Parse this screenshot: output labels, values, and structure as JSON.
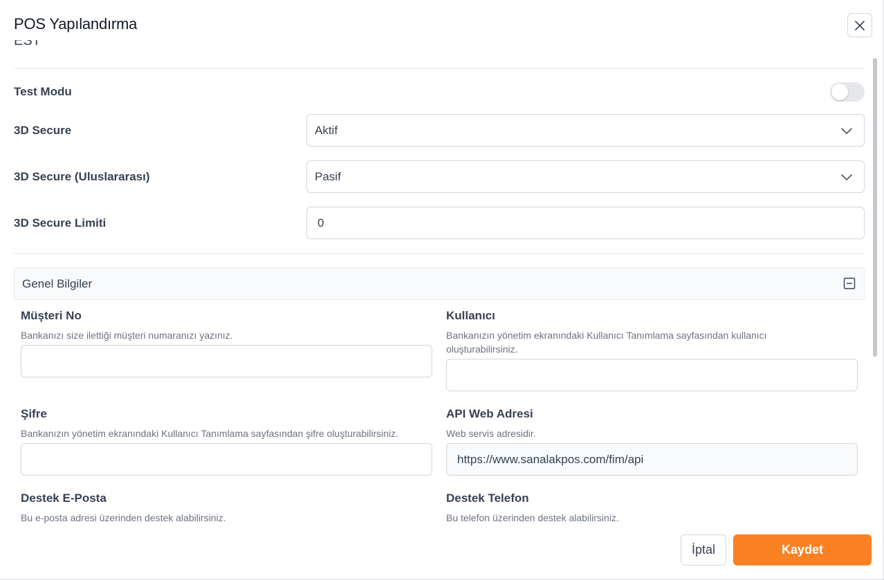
{
  "modal": {
    "title": "POS Yapılandırma",
    "close_icon": "close-icon"
  },
  "top_clipped_text": "EST",
  "settings": {
    "test_mode": {
      "label": "Test Modu",
      "enabled": false
    },
    "secure_3d": {
      "label": "3D Secure",
      "value": "Aktif"
    },
    "secure_3d_intl": {
      "label": "3D Secure (Uluslararası)",
      "value": "Pasif"
    },
    "secure_3d_limit": {
      "label": "3D Secure Limiti",
      "value": "0"
    }
  },
  "panel": {
    "title": "Genel Bilgiler",
    "collapse_icon": "minus-square-icon"
  },
  "fields": {
    "customer_no": {
      "label": "Müşteri No",
      "help": "Bankanızı size ilettiği müşteri numaranızı yazınız.",
      "value": ""
    },
    "user": {
      "label": "Kullanıcı",
      "help_line1": "Bankanızın yönetim ekranındaki Kullanıcı Tanımlama sayfasından kullanıcı",
      "help_line2": "oluşturabilirsiniz.",
      "value": ""
    },
    "password": {
      "label": "Şifre",
      "help": "Bankanızın yönetim ekranındaki Kullanıcı Tanımlama sayfasından şifre oluşturabilirsiniz.",
      "value": ""
    },
    "api_url": {
      "label": "API Web Adresi",
      "help": "Web servis adresidir.",
      "value": "https://www.sanalakpos.com/fim/api"
    },
    "support_email": {
      "label": "Destek E-Posta",
      "help": "Bu e-posta adresi üzerinden destek alabilirsiniz."
    },
    "support_phone": {
      "label": "Destek Telefon",
      "help": "Bu telefon üzerinden destek alabilirsiniz."
    }
  },
  "footer": {
    "cancel_label": "İptal",
    "save_label": "Kaydet"
  },
  "colors": {
    "accent": "#fb8123",
    "border": "#d1d5db",
    "panel_bg": "#f8fafc"
  }
}
